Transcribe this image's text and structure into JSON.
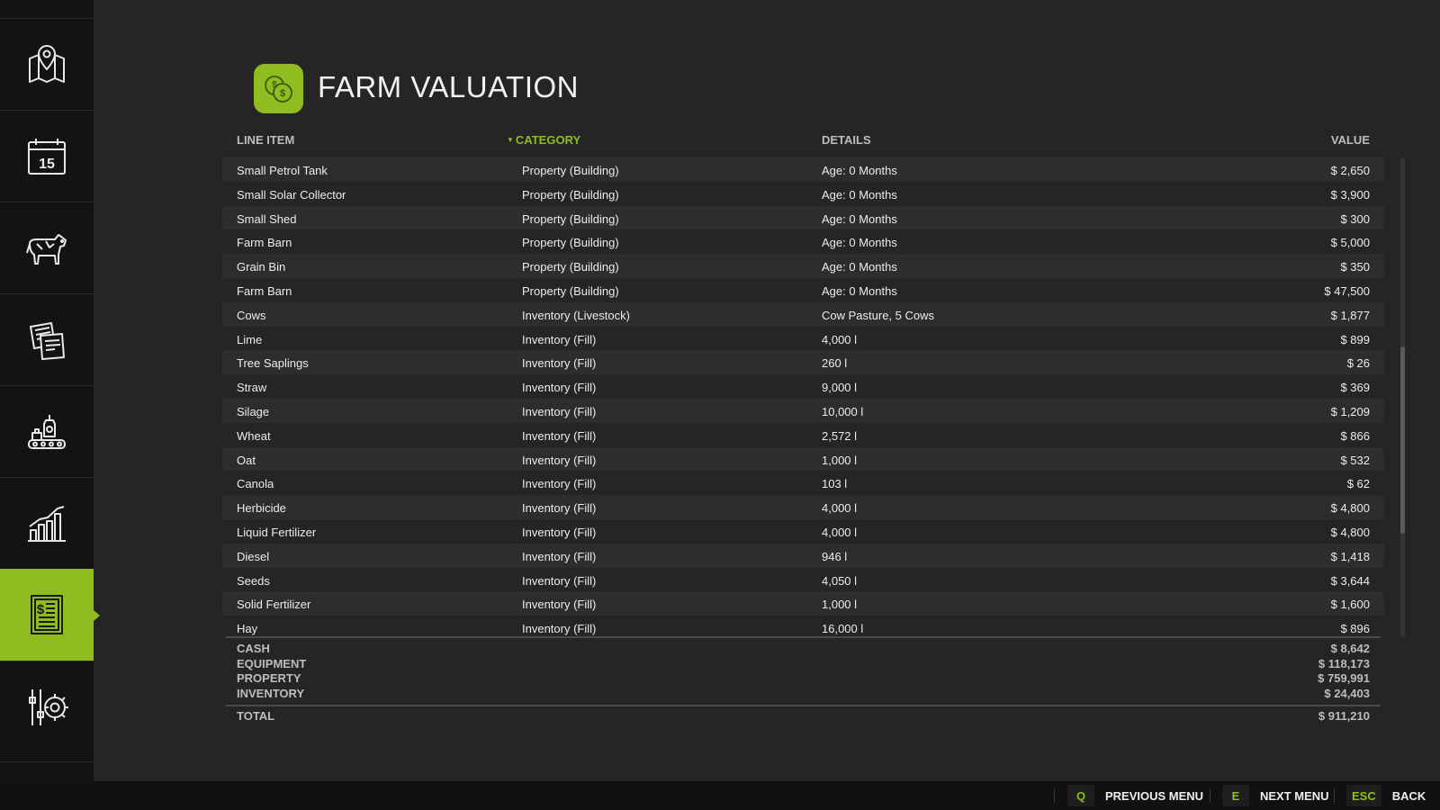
{
  "header": {
    "title": "FARM VALUATION",
    "icon": "coins-icon"
  },
  "sidebar": {
    "items": [
      {
        "icon": "map-icon",
        "active": false
      },
      {
        "icon": "calendar-icon",
        "label": "15",
        "active": false
      },
      {
        "icon": "cow-icon",
        "active": false
      },
      {
        "icon": "contracts-icon",
        "active": false
      },
      {
        "icon": "production-icon",
        "active": false
      },
      {
        "icon": "statistics-icon",
        "active": false
      },
      {
        "icon": "finances-icon",
        "active": true
      },
      {
        "icon": "settings-icon",
        "active": false
      }
    ]
  },
  "table": {
    "columns": [
      "LINE ITEM",
      "CATEGORY",
      "DETAILS",
      "VALUE"
    ],
    "sort_column": "CATEGORY",
    "rows": [
      [
        "Small Petrol Tank",
        "Property (Building)",
        "Age: 0 Months",
        "$ 2,650"
      ],
      [
        "Small Solar Collector",
        "Property (Building)",
        "Age: 0 Months",
        "$ 3,900"
      ],
      [
        "Small Shed",
        "Property (Building)",
        "Age: 0 Months",
        "$ 300"
      ],
      [
        "Farm Barn",
        "Property (Building)",
        "Age: 0 Months",
        "$ 5,000"
      ],
      [
        "Grain Bin",
        "Property (Building)",
        "Age: 0 Months",
        "$ 350"
      ],
      [
        "Farm Barn",
        "Property (Building)",
        "Age: 0 Months",
        "$ 47,500"
      ],
      [
        "Cows",
        "Inventory (Livestock)",
        "Cow Pasture, 5 Cows",
        "$ 1,877"
      ],
      [
        "Lime",
        "Inventory (Fill)",
        "4,000 l",
        "$ 899"
      ],
      [
        "Tree Saplings",
        "Inventory (Fill)",
        "260 l",
        "$ 26"
      ],
      [
        "Straw",
        "Inventory (Fill)",
        "9,000 l",
        "$ 369"
      ],
      [
        "Silage",
        "Inventory (Fill)",
        "10,000 l",
        "$ 1,209"
      ],
      [
        "Wheat",
        "Inventory (Fill)",
        "2,572 l",
        "$ 866"
      ],
      [
        "Oat",
        "Inventory (Fill)",
        "1,000 l",
        "$ 532"
      ],
      [
        "Canola",
        "Inventory (Fill)",
        "103 l",
        "$ 62"
      ],
      [
        "Herbicide",
        "Inventory (Fill)",
        "4,000 l",
        "$ 4,800"
      ],
      [
        "Liquid Fertilizer",
        "Inventory (Fill)",
        "4,000 l",
        "$ 4,800"
      ],
      [
        "Diesel",
        "Inventory (Fill)",
        "946 l",
        "$ 1,418"
      ],
      [
        "Seeds",
        "Inventory (Fill)",
        "4,050 l",
        "$ 3,644"
      ],
      [
        "Solid Fertilizer",
        "Inventory (Fill)",
        "1,000 l",
        "$ 1,600"
      ],
      [
        "Hay",
        "Inventory (Fill)",
        "16,000 l",
        "$ 896"
      ]
    ]
  },
  "summary": {
    "rows": [
      {
        "label": "CASH",
        "value": "$ 8,642"
      },
      {
        "label": "EQUIPMENT",
        "value": "$ 118,173"
      },
      {
        "label": "PROPERTY",
        "value": "$ 759,991"
      },
      {
        "label": "INVENTORY",
        "value": "$ 24,403"
      }
    ],
    "total": {
      "label": "TOTAL",
      "value": "$ 911,210"
    }
  },
  "footer": {
    "buttons": [
      {
        "key": "Q",
        "label": "PREVIOUS MENU"
      },
      {
        "key": "E",
        "label": "NEXT MENU"
      },
      {
        "key": "ESC",
        "label": "BACK"
      }
    ]
  },
  "colors": {
    "accent": "#8fbc1f",
    "background": "#252525",
    "sidebar": "#131313",
    "row_alt": "#2d2d2d"
  }
}
